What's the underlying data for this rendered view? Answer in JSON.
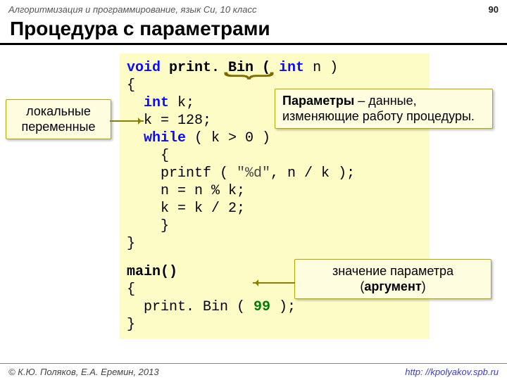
{
  "header": {
    "course": "Алгоритмизация и программирование, язык Си, 10 класс",
    "page": "90"
  },
  "title": "Процедура с параметрами",
  "code1": {
    "l1a": "void",
    "l1b": " print. Bin ( ",
    "l1c": "int",
    "l1d": " n )",
    "l2": "{",
    "l3a": "  ",
    "l3b": "int",
    "l3c": " k;",
    "l4": "  k = 128;",
    "l5a": "  ",
    "l5b": "while",
    "l5c": " ( k > 0 )",
    "l6": "    {",
    "l7a": "    printf ( ",
    "l7b": "\"%d\"",
    "l7c": ", n / k );",
    "l8": "    n = n % k;",
    "l9": "    k = k / 2;",
    "l10": "    }",
    "l11": "}"
  },
  "code2": {
    "l1": "main()",
    "l2": "{",
    "l3a": "  print. Bin ( ",
    "l3b": "99",
    "l3c": " );",
    "l4": "}"
  },
  "callouts": {
    "local_vars": "локальные переменные",
    "params_b": "Параметры",
    "params_rest": " – данные, изменяющие работу процедуры.",
    "arg_line1": "значение параметра",
    "arg_line2a": "(",
    "arg_line2b": "аргумент",
    "arg_line2c": ")"
  },
  "footer": {
    "copyright": "© К.Ю. Поляков, Е.А. Еремин, 2013",
    "url": "http: //kpolyakov.spb.ru"
  }
}
